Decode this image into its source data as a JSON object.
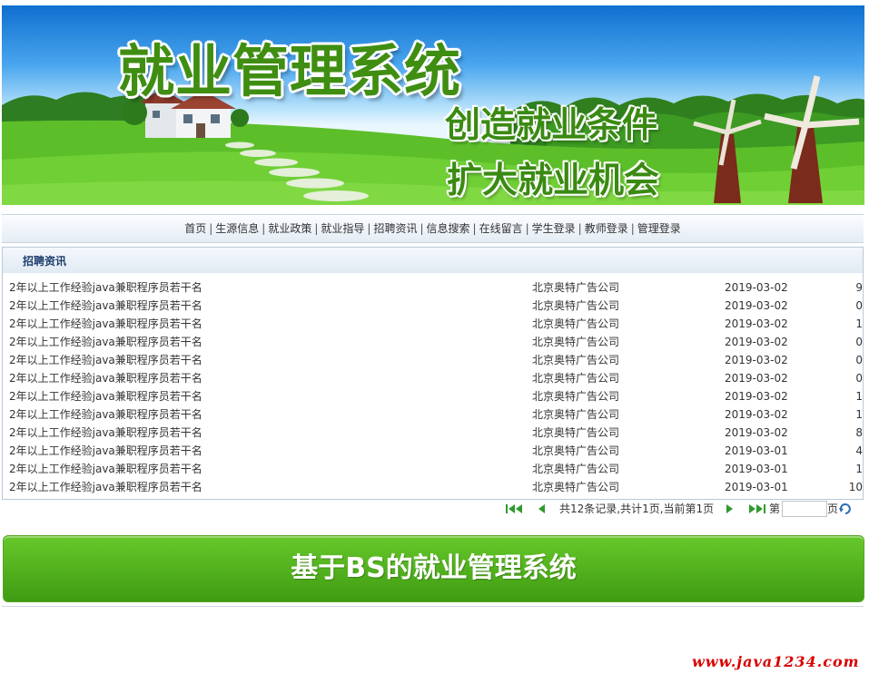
{
  "banner": {
    "title": "就业管理系统",
    "slogan_1": "创造就业条件",
    "slogan_2": "扩大就业机会"
  },
  "nav": {
    "items": [
      {
        "label": "首页"
      },
      {
        "label": "生源信息"
      },
      {
        "label": "就业政策"
      },
      {
        "label": "就业指导"
      },
      {
        "label": "招聘资讯"
      },
      {
        "label": "信息搜索"
      },
      {
        "label": "在线留言"
      },
      {
        "label": "学生登录"
      },
      {
        "label": "教师登录"
      },
      {
        "label": "管理登录"
      }
    ],
    "separator": "|"
  },
  "panel": {
    "heading": "招聘资讯",
    "rows": [
      {
        "title": "2年以上工作经验java兼职程序员若干名",
        "company": "北京奥特广告公司",
        "date": "2019-03-02",
        "count": "9"
      },
      {
        "title": "2年以上工作经验java兼职程序员若干名",
        "company": "北京奥特广告公司",
        "date": "2019-03-02",
        "count": "0"
      },
      {
        "title": "2年以上工作经验java兼职程序员若干名",
        "company": "北京奥特广告公司",
        "date": "2019-03-02",
        "count": "1"
      },
      {
        "title": "2年以上工作经验java兼职程序员若干名",
        "company": "北京奥特广告公司",
        "date": "2019-03-02",
        "count": "0"
      },
      {
        "title": "2年以上工作经验java兼职程序员若干名",
        "company": "北京奥特广告公司",
        "date": "2019-03-02",
        "count": "0"
      },
      {
        "title": "2年以上工作经验java兼职程序员若干名",
        "company": "北京奥特广告公司",
        "date": "2019-03-02",
        "count": "0"
      },
      {
        "title": "2年以上工作经验java兼职程序员若干名",
        "company": "北京奥特广告公司",
        "date": "2019-03-02",
        "count": "1"
      },
      {
        "title": "2年以上工作经验java兼职程序员若干名",
        "company": "北京奥特广告公司",
        "date": "2019-03-02",
        "count": "1"
      },
      {
        "title": "2年以上工作经验java兼职程序员若干名",
        "company": "北京奥特广告公司",
        "date": "2019-03-02",
        "count": "8"
      },
      {
        "title": "2年以上工作经验java兼职程序员若干名",
        "company": "北京奥特广告公司",
        "date": "2019-03-01",
        "count": "4"
      },
      {
        "title": "2年以上工作经验java兼职程序员若干名",
        "company": "北京奥特广告公司",
        "date": "2019-03-01",
        "count": "1"
      },
      {
        "title": "2年以上工作经验java兼职程序员若干名",
        "company": "北京奥特广告公司",
        "date": "2019-03-01",
        "count": "10"
      }
    ]
  },
  "pager": {
    "summary": "共12条记录,共计1页,当前第1页",
    "goto_prefix": "第",
    "goto_suffix": "页",
    "page_input_value": "",
    "icons": [
      "first-page-icon",
      "prev-page-icon",
      "next-page-icon",
      "last-page-icon",
      "go-icon"
    ],
    "icon_color": "#2e9a2e"
  },
  "footer": {
    "title": "基于BS的就业管理系统"
  },
  "watermark": "www.java1234.com",
  "colors": {
    "footer_green": "#4aa81a",
    "title_green": "#3f8e12",
    "panel_heading": "#1c3c6b",
    "watermark_red": "#d80000"
  }
}
